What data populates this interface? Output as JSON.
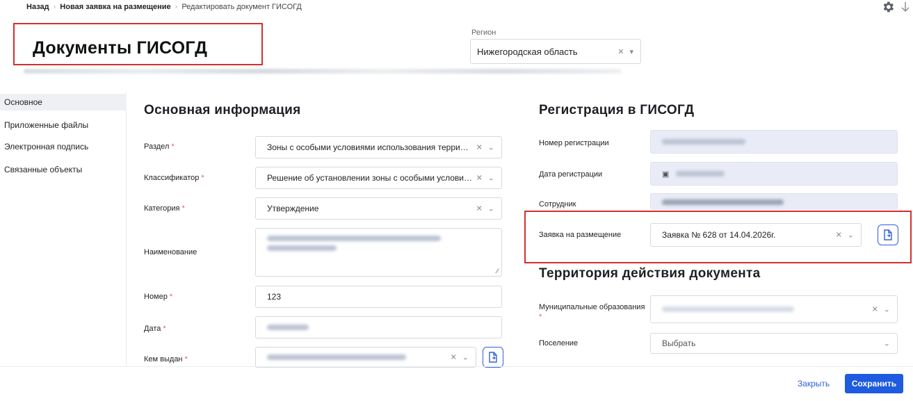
{
  "breadcrumb": {
    "back": "Назад",
    "parent": "Новая заявка на размещение",
    "current": "Редактировать документ ГИСОГД"
  },
  "page_title": "Документы ГИСОГД",
  "region": {
    "label": "Регион",
    "value": "Нижегородская область"
  },
  "nav": {
    "items": [
      {
        "label": "Основное"
      },
      {
        "label": "Приложенные файлы"
      },
      {
        "label": "Электронная подпись"
      },
      {
        "label": "Связанные объекты"
      }
    ]
  },
  "main_info": {
    "title": "Основная информация",
    "razdel": {
      "label": "Раздел",
      "value": "Зоны с особыми условиями использования терри…"
    },
    "klassifikator": {
      "label": "Классификатор",
      "value": "Решение об установлении зоны с особыми услови…"
    },
    "kategoriya": {
      "label": "Категория",
      "value": "Утверждение"
    },
    "naimenovanie": {
      "label": "Наименование"
    },
    "nomer": {
      "label": "Номер",
      "value": "123"
    },
    "data": {
      "label": "Дата"
    },
    "kem_vydan": {
      "label": "Кем выдан"
    }
  },
  "registration": {
    "title": "Регистрация в ГИСОГД",
    "nomer_label": "Номер регистрации",
    "data_label": "Дата регистрации",
    "sotrudnik_label": "Сотрудник",
    "zayavka": {
      "label": "Заявка на размещение",
      "value": "Заявка № 628 от 14.04.2026г."
    }
  },
  "territory": {
    "title": "Территория действия документа",
    "mo_label": "Муниципальные образования",
    "poselenie": {
      "label": "Поселение",
      "placeholder": "Выбрать"
    }
  },
  "footer": {
    "close": "Закрыть",
    "save": "Сохранить"
  },
  "colors": {
    "accent": "#1e5be0",
    "highlight": "#d32f2f",
    "required": "#e35d5d",
    "filled_bg": "#e9ecf6"
  }
}
